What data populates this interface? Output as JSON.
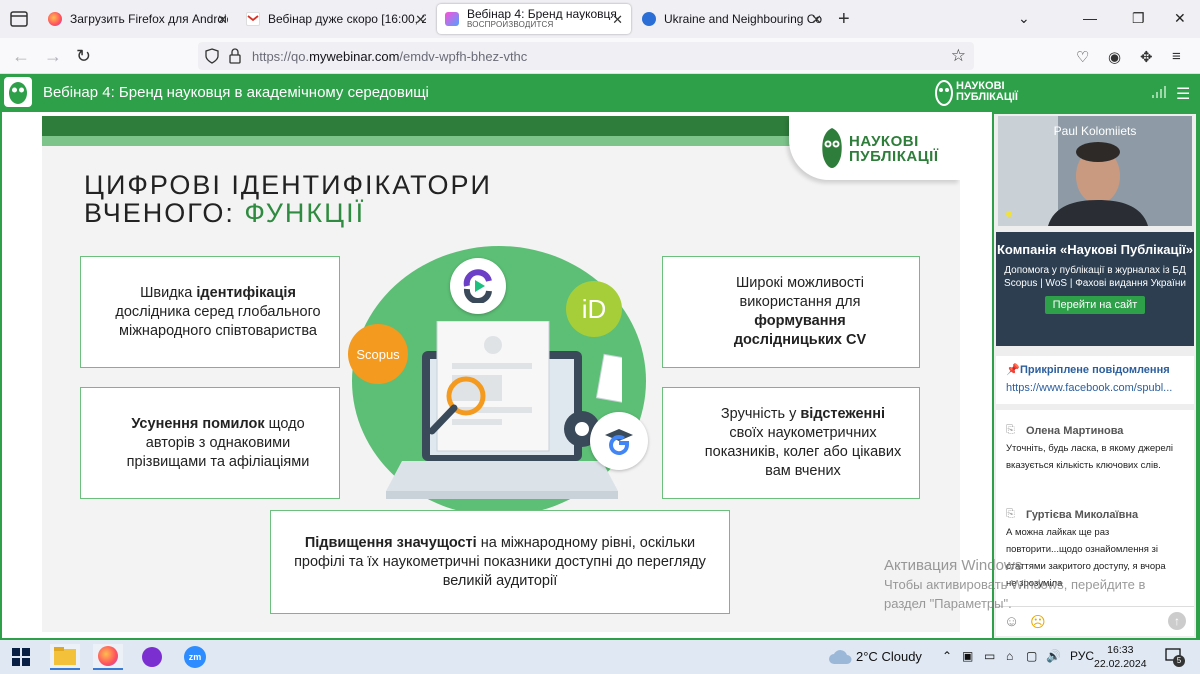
{
  "browser": {
    "tabs": [
      {
        "title": "Загрузить Firefox для Android",
        "icon": "firefox-icon"
      },
      {
        "title": "Вебінар дуже скоро [16:00, 22.",
        "icon": "gmail-icon"
      },
      {
        "title": "Вебінар 4: Бренд науковця в а",
        "subtitle": "ВОСПРОИЗВОДИТСЯ",
        "icon": "mywebinar-icon",
        "active": true
      },
      {
        "title": "Ukraine and Neighbouring Cou",
        "icon": "globe-icon"
      }
    ],
    "url_prefix": "https://qo.",
    "url_domain": "mywebinar.com",
    "url_path": "/emdv-wpfh-bhez-vthc"
  },
  "webinar": {
    "title": "Вебінар 4: Бренд науковця в академічному середовищі",
    "brand_line1": "НАУКОВІ",
    "brand_line2": "ПУБЛІКАЦІЇ"
  },
  "slide": {
    "title_line1": "ЦИФРОВІ ІДЕНТИФІКАТОРИ",
    "title_line2_prefix": "ВЧЕНОГО: ",
    "title_line2_accent": "ФУНКЦІЇ",
    "logo_line1": "НАУКОВІ",
    "logo_line2": "ПУБЛІКАЦІЇ",
    "scopus_label": "Scopus",
    "orcid_label": "iD",
    "card1": {
      "a": "Швидка ",
      "b": "ідентифікація",
      "c": " дослідника серед глобального міжнародного співтовариства"
    },
    "card2": {
      "a": "Широкі можливості використання для ",
      "b": "формування дослідницьких CV",
      "c": ""
    },
    "card3": {
      "a": "",
      "b": "Усунення помилок",
      "c": " щодо авторів з однаковими прізвищами та афіліаціями"
    },
    "card4": {
      "a": "Зручність у ",
      "b": "відстеженні",
      "c": " своїх наукометричних  показників, колег або цікавих вам вчених"
    },
    "card5": {
      "a": "",
      "b": "Підвищення значущості",
      "c": " на міжнародному рівні, оскільки профілі та їх наукометричні показники доступні до перегляду великій аудиторії"
    }
  },
  "side": {
    "presenter": "Paul Kolomiiets",
    "company_name": "Компанія «Наукові Публікації»",
    "company_desc": "Допомога у публікації в журналах із БД Scopus | WoS | Фахові видання України",
    "visit_button": "Перейти на сайт",
    "pinned_label": "Прикріплене повідомлення",
    "pinned_link": "https://www.facebook.com/spubl...",
    "messages": [
      {
        "author": "Олена Мартинова",
        "text": "Уточніть, будь ласка, в якому джерелі вказується кількість ключових слів."
      },
      {
        "author": "Гуртієва Миколаївна",
        "text": "А можна лайкак ще раз повторити...щодо ознайомлення зі статтями закритого доступу, я вчора не зрозуміла"
      }
    ]
  },
  "watermark": {
    "line1": "Активация Windows",
    "line2": "Чтобы активировать Windows, перейдите в",
    "line3": "раздел \"Параметры\"."
  },
  "taskbar": {
    "weather_temp": "2°C",
    "weather_desc": "Cloudy",
    "lang": "РУС",
    "time": "16:33",
    "date": "22.02.2024",
    "notif_count": "5"
  },
  "colors": {
    "brand_green": "#2ea04a",
    "dark_green": "#2e7d3b",
    "accent_orange": "#f39a1f"
  }
}
